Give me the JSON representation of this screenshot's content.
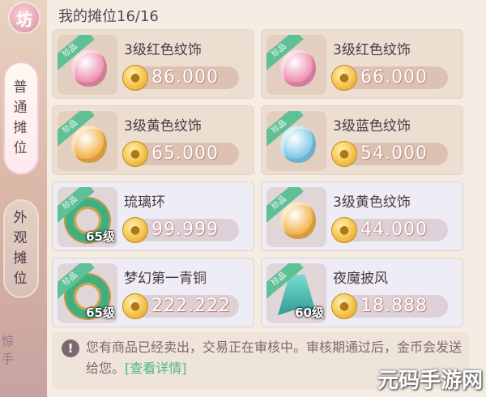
{
  "sidebar": {
    "badge": "坊",
    "tabs": [
      {
        "label": [
          "普",
          "通",
          "摊",
          "位"
        ],
        "active": true
      },
      {
        "label": [
          "外",
          "观",
          "摊",
          "位"
        ],
        "active": false
      }
    ],
    "bottom_text": "惊\n手"
  },
  "panel": {
    "title": "我的摊位16/16"
  },
  "ribbon_label": "珍品",
  "items": [
    {
      "name": "3级红色纹饰",
      "price": "86.000",
      "level": "",
      "icon": "red-gem",
      "color": "#ef8fb0"
    },
    {
      "name": "3级红色纹饰",
      "price": "66.000",
      "level": "",
      "icon": "red-gem",
      "color": "#ef8fb0"
    },
    {
      "name": "3级黄色纹饰",
      "price": "65.000",
      "level": "",
      "icon": "yellow-gem",
      "color": "#f2b24a"
    },
    {
      "name": "3级蓝色纹饰",
      "price": "54.000",
      "level": "",
      "icon": "blue-gem",
      "color": "#7fc8e6"
    },
    {
      "name": "琉璃环",
      "price": "99.999",
      "level": "65级",
      "icon": "ring",
      "color": "#3faf7f"
    },
    {
      "name": "3级黄色纹饰",
      "price": "44.000",
      "level": "",
      "icon": "yellow-gem",
      "color": "#f2b24a"
    },
    {
      "name": "梦幻第一青铜",
      "price": "222.222",
      "level": "65级",
      "icon": "ring",
      "color": "#3faf7f"
    },
    {
      "name": "夜魔披风",
      "price": "18.888",
      "level": "60级",
      "icon": "cloak",
      "color": "#45b9ad"
    }
  ],
  "notice": {
    "text": "您有商品已经卖出，交易正在审核中。审核期通过后，金币会发送给您。",
    "link": "[查看详情]"
  },
  "watermark": "元码手游网"
}
